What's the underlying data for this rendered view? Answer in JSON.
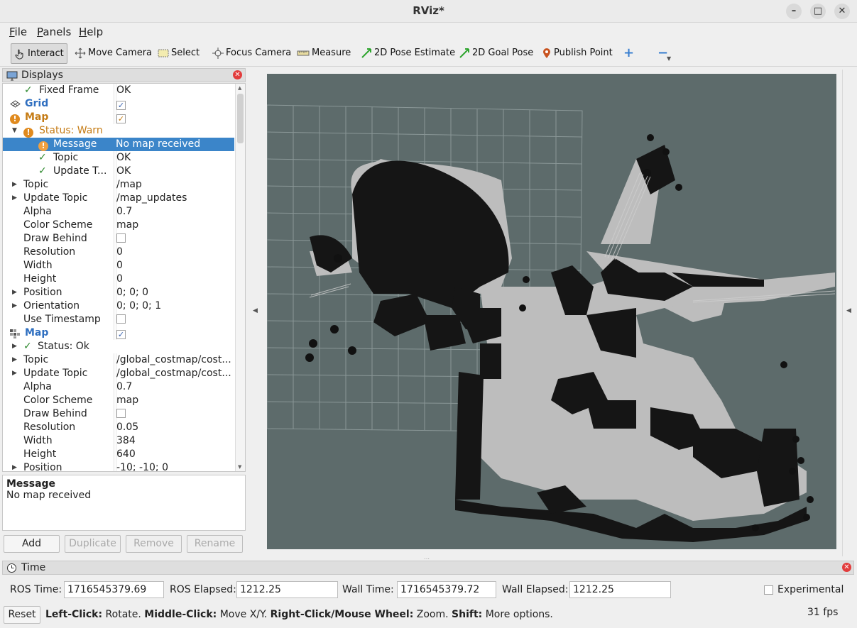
{
  "window": {
    "title": "RViz*"
  },
  "menu": {
    "file_u": "F",
    "file_rest": "ile",
    "panels_u": "P",
    "panels_rest": "anels",
    "help_u": "H",
    "help_rest": "elp"
  },
  "toolbar": {
    "interact": "Interact",
    "move_camera": "Move Camera",
    "select": "Select",
    "focus_camera": "Focus Camera",
    "measure": "Measure",
    "pose_estimate": "2D Pose Estimate",
    "goal_pose": "2D Goal Pose",
    "publish_point": "Publish Point"
  },
  "displays": {
    "title": "Displays",
    "rows": [
      {
        "key": "Fixed Frame",
        "value": "OK"
      },
      {
        "key": "Grid",
        "value": ""
      },
      {
        "key": "Map",
        "value": ""
      },
      {
        "key": "Status: Warn",
        "value": ""
      },
      {
        "key": "Message",
        "value": "No map received"
      },
      {
        "key": "Topic",
        "value": "OK"
      },
      {
        "key": "Update T...",
        "value": "OK"
      },
      {
        "key": "Topic",
        "value": "/map"
      },
      {
        "key": "Update Topic",
        "value": "/map_updates"
      },
      {
        "key": "Alpha",
        "value": "0.7"
      },
      {
        "key": "Color Scheme",
        "value": "map"
      },
      {
        "key": "Draw Behind",
        "value": ""
      },
      {
        "key": "Resolution",
        "value": "0"
      },
      {
        "key": "Width",
        "value": "0"
      },
      {
        "key": "Height",
        "value": "0"
      },
      {
        "key": "Position",
        "value": "0; 0; 0"
      },
      {
        "key": "Orientation",
        "value": "0; 0; 0; 1"
      },
      {
        "key": "Use Timestamp",
        "value": ""
      },
      {
        "key": "Map",
        "value": ""
      },
      {
        "key": "Status: Ok",
        "value": ""
      },
      {
        "key": "Topic",
        "value": "/global_costmap/cost..."
      },
      {
        "key": "Update Topic",
        "value": "/global_costmap/cost..."
      },
      {
        "key": "Alpha",
        "value": "0.7"
      },
      {
        "key": "Color Scheme",
        "value": "map"
      },
      {
        "key": "Draw Behind",
        "value": ""
      },
      {
        "key": "Resolution",
        "value": "0.05"
      },
      {
        "key": "Width",
        "value": "384"
      },
      {
        "key": "Height",
        "value": "640"
      },
      {
        "key": "Position",
        "value": "-10; -10; 0"
      }
    ],
    "description": {
      "title": "Message",
      "text": "No map received"
    },
    "buttons": {
      "add": "Add",
      "duplicate": "Duplicate",
      "remove": "Remove",
      "rename": "Rename"
    }
  },
  "time": {
    "title": "Time",
    "ros_time_label": "ROS Time:",
    "ros_time": "1716545379.69",
    "ros_elapsed_label": "ROS Elapsed:",
    "ros_elapsed": "1212.25",
    "wall_time_label": "Wall Time:",
    "wall_time": "1716545379.72",
    "wall_elapsed_label": "Wall Elapsed:",
    "wall_elapsed": "1212.25",
    "experimental": "Experimental"
  },
  "status": {
    "reset": "Reset",
    "h1_b": "Left-Click:",
    "h1": " Rotate. ",
    "h2_b": "Middle-Click:",
    "h2": " Move X/Y. ",
    "h3_b": "Right-Click/Mouse Wheel:",
    "h3": " Zoom. ",
    "h4_b": "Shift:",
    "h4": " More options.",
    "fps": "31 fps"
  },
  "colors": {
    "selection": "#3b85c9",
    "view_background": "#5d6b6b",
    "warn": "#e08a1e",
    "ok": "#2f8a2f"
  }
}
